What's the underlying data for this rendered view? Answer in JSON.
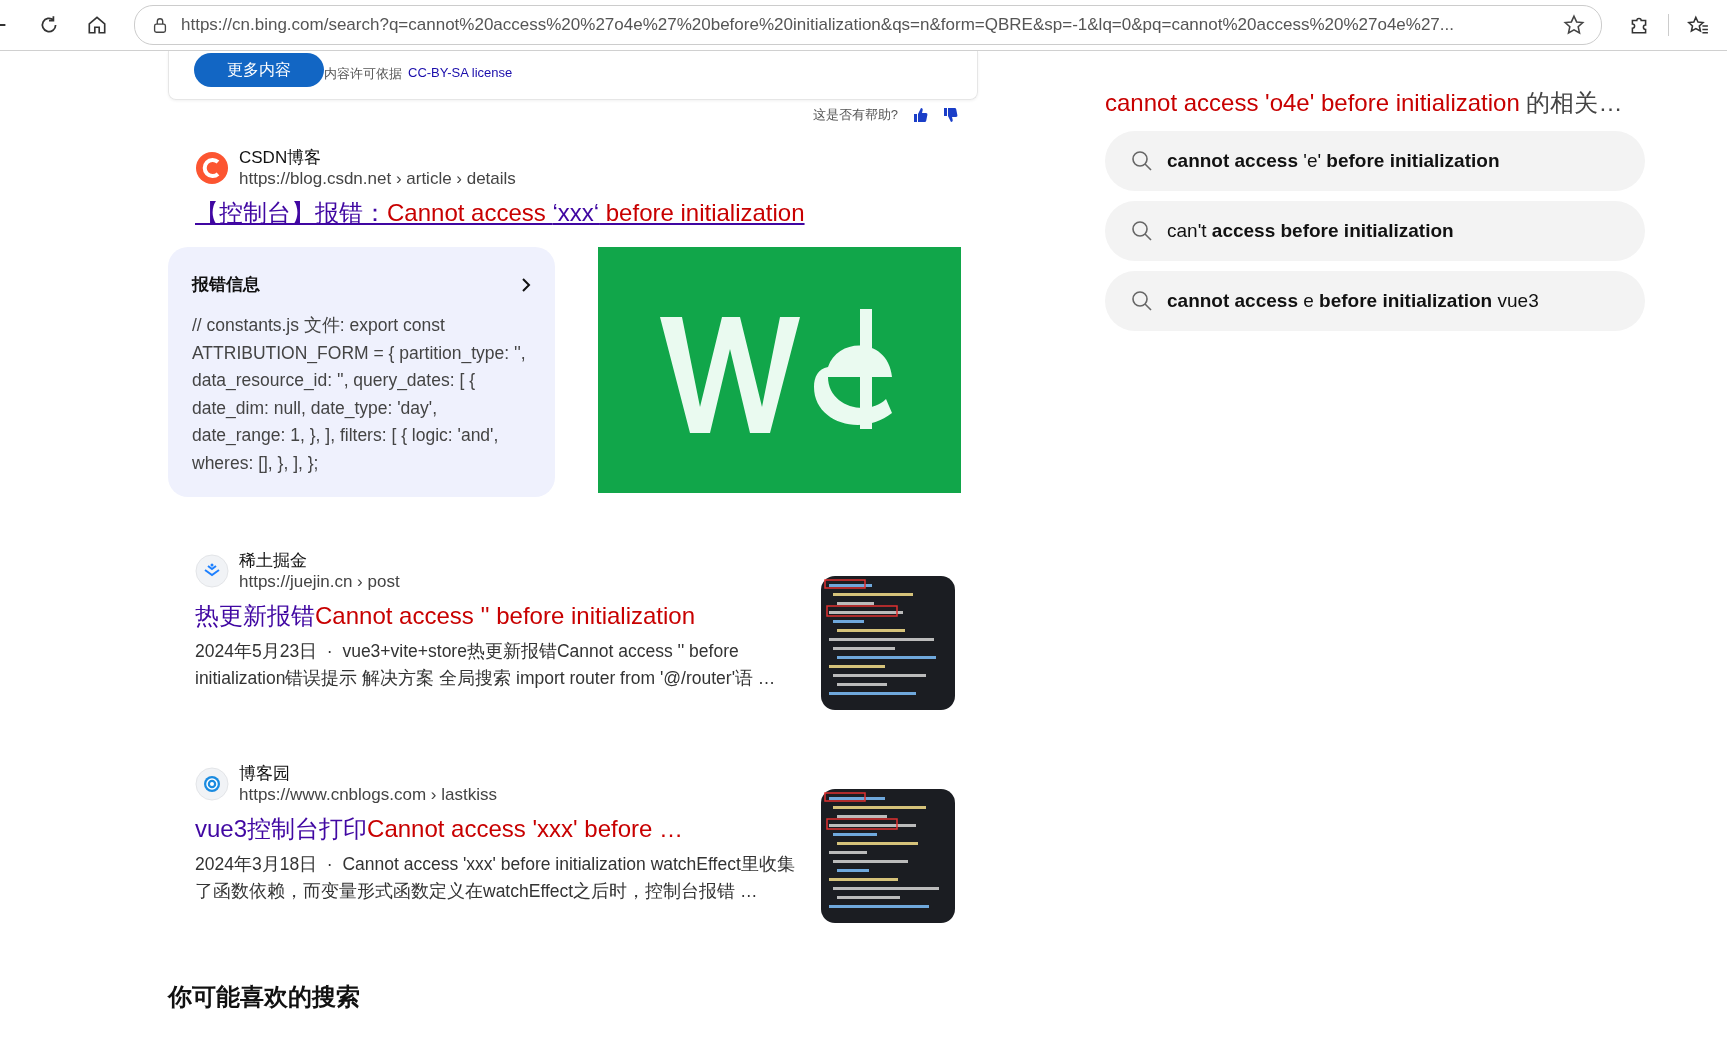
{
  "browser": {
    "url": "https://cn.bing.com/search?q=cannot%20access%20%27o4e%27%20before%20initialization&qs=n&form=QBRE&sp=-1&lq=0&pq=cannot%20access%20%27o4e%27..."
  },
  "answer_card": {
    "more_button": "更多内容",
    "license_label": "内容许可依据",
    "license_link": "CC-BY-SA license"
  },
  "feedback": {
    "question": "这是否有帮助?"
  },
  "results": [
    {
      "kind": "featured",
      "favicon": {
        "kind": "csdn"
      },
      "source": "CSDN博客",
      "url": "https://blog.csdn.net › article › details",
      "title": [
        {
          "text": "【控制台】报错：",
          "match": false
        },
        {
          "text": "Cannot access ",
          "match": true
        },
        {
          "text": "‘xxx‘",
          "match": false
        },
        {
          "text": " before initialization",
          "match": true
        }
      ],
      "info_card": {
        "title": "报错信息",
        "text": "// constants.js 文件: export const ATTRIBUTION_FORM = { partition_type: '', data_resource_id: '', query_dates: [ { date_dim: null, date_type: 'day', date_range: 1, }, ], filters: [ { logic: 'and', wheres: [], }, ], };"
      },
      "thumbnail": {
        "kind": "picture"
      }
    },
    {
      "kind": "standard",
      "favicon": {
        "kind": "juejin"
      },
      "source": "稀土掘金",
      "url": "https://juejin.cn › post",
      "title": [
        {
          "text": "热更新报错",
          "match": false
        },
        {
          "text": "Cannot access '' before initialization",
          "match": true
        }
      ],
      "date": "2024年5月23日",
      "separator": "·",
      "snippet": "vue3+vite+store热更新报错Cannot access '' before initialization错误提示 解决方案 全局搜索 import router from '@/router'语 …",
      "thumbnail": {
        "kind": "picture"
      }
    },
    {
      "kind": "standard",
      "favicon": {
        "kind": "cnblogs"
      },
      "source": "博客园",
      "url": "https://www.cnblogs.com › lastkiss",
      "title": [
        {
          "text": "vue3控制台打印",
          "match": false
        },
        {
          "text": "Cannot access 'xxx' before …",
          "match": true
        }
      ],
      "date": "2024年3月18日",
      "separator": "·",
      "snippet": "Cannot access 'xxx' before initialization watchEffect里收集了函数依赖，而变量形式函数定义在watchEffect之后时，控制台报错 …",
      "thumbnail": {
        "kind": "picture"
      }
    }
  ],
  "more_searches": {
    "heading": "你可能喜欢的搜索"
  },
  "related": {
    "query": "cannot access 'o4e' before initialization",
    "suffix": "的相关…",
    "items": [
      "**cannot access** 'e' **before initialization**",
      "can't **access before initialization**",
      "**cannot access** e **before initialization** vue3"
    ]
  }
}
